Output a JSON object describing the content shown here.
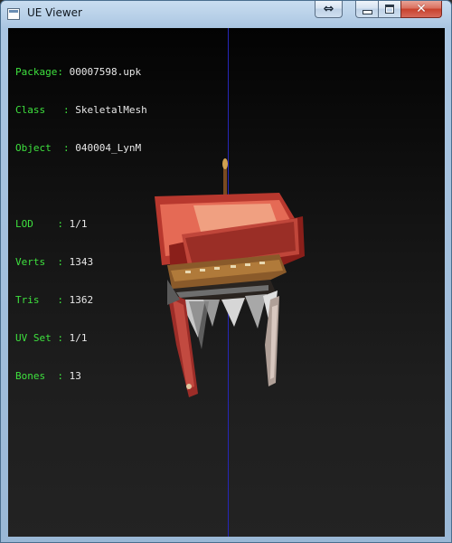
{
  "window": {
    "title": "UE Viewer",
    "buttons": {
      "swap": "⇔",
      "close": "✕"
    }
  },
  "info": {
    "package": {
      "label": "Package",
      "value": "00007598.upk"
    },
    "class": {
      "label": "Class",
      "value": "SkeletalMesh"
    },
    "object": {
      "label": "Object",
      "value": "040004_LynM"
    },
    "lod": {
      "label": "LOD",
      "value": "1/1"
    },
    "verts": {
      "label": "Verts",
      "value": "1343"
    },
    "tris": {
      "label": "Tris",
      "value": "1362"
    },
    "uvset": {
      "label": "UV Set",
      "value": "1/1"
    },
    "bones": {
      "label": "Bones",
      "value": "13"
    }
  },
  "colors": {
    "label": "#3ee13e",
    "value": "#e8e8e8",
    "axis": "#2626b8"
  }
}
